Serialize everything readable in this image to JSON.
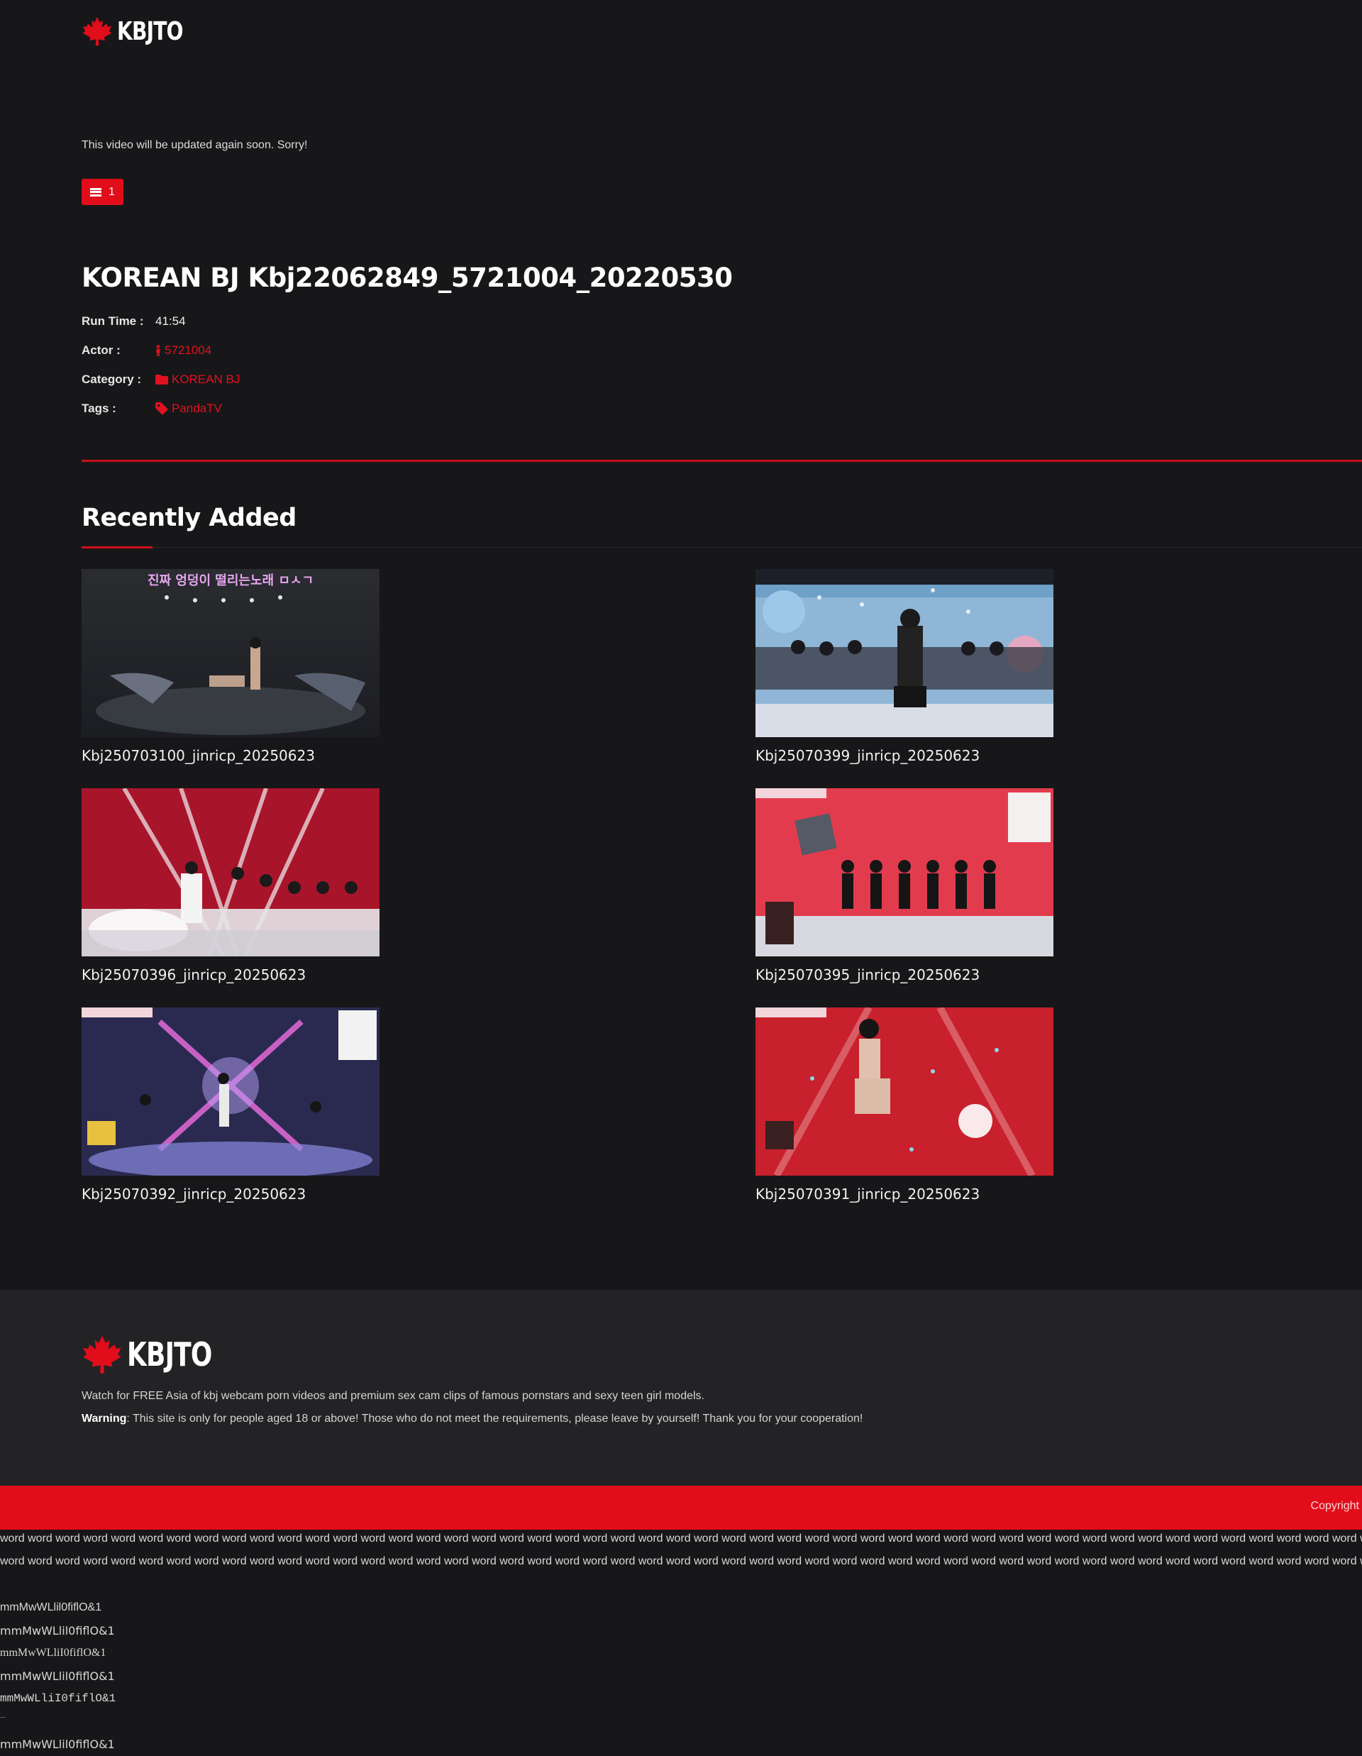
{
  "header": {
    "logo_text": "KBJTO"
  },
  "notice": "This video will be updated again soon. Sorry!",
  "server_badge": {
    "label": "1"
  },
  "video": {
    "title": "KOREAN BJ Kbj22062849_5721004_20220530",
    "run_time_label": "Run Time :",
    "run_time": "41:54",
    "actor_label": "Actor :",
    "actor": "5721004",
    "category_label": "Category :",
    "category": "KOREAN BJ",
    "tags_label": "Tags :",
    "tag": "PandaTV"
  },
  "recent": {
    "heading": "Recently Added",
    "items": [
      {
        "title": "Kbj250703100_jinricp_20250623",
        "overlay": "진짜 엉덩이 떨리는노래 ㅁㅅㄱ"
      },
      {
        "title": "Kbj25070399_jinricp_20250623",
        "overlay": ""
      },
      {
        "title": "Kbj25070396_jinricp_20250623",
        "overlay": ""
      },
      {
        "title": "Kbj25070395_jinricp_20250623",
        "overlay": ""
      },
      {
        "title": "Kbj25070392_jinricp_20250623",
        "overlay": ""
      },
      {
        "title": "Kbj25070391_jinricp_20250623",
        "overlay": ""
      }
    ]
  },
  "footer": {
    "logo_text": "KBJTO",
    "description": "Watch for FREE Asia of kbj webcam porn videos and premium sex cam clips of famous pornstars and sexy teen girl models.",
    "warning_label": "Warning",
    "warning_text": ": This site is only for people aged 18 or above! Those who do not meet the requirements, please leave by yourself! Thank you for your cooperation!",
    "copyright": "Copyright"
  },
  "filler": {
    "word_line": "word word word word word word word word word word word word word word word word word word word word word word word word word word word word word word word word word word word word word word word word word word word word word word word word word word word word word",
    "font_samples": [
      "mmMwWLlil0fiflO&1",
      "mmMwWLlil0fiflO&1",
      "mmMwWLliI0fiflO&1",
      "mmMwWLlil0fiflO&1",
      "mmMwWLliI0fiflO&1",
      "...",
      "mmMwWLlil0fiflO&1"
    ]
  },
  "colors": {
    "accent": "#e10d1b",
    "background": "#171719",
    "footer_bg": "#232325"
  }
}
